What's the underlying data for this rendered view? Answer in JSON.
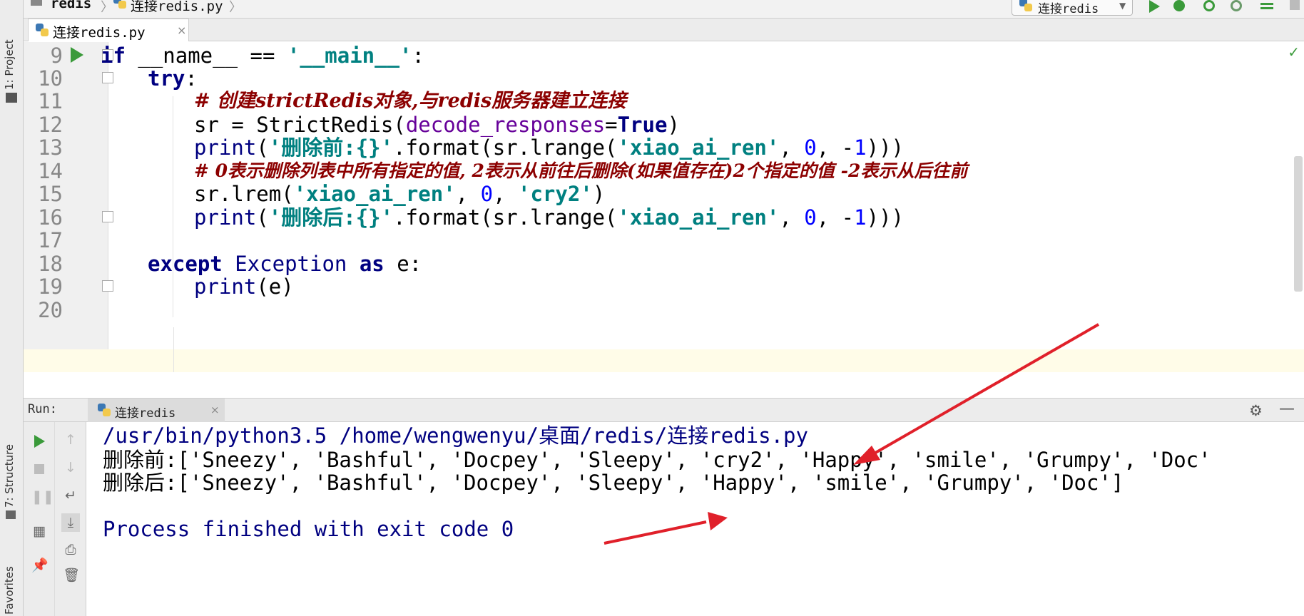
{
  "navbar": {
    "project": "redis",
    "file": "连接redis.py",
    "run_config": "连接redis"
  },
  "left_strip": {
    "project_tab": "1: Project",
    "structure_tab": "7: Structure",
    "favorites_tab": "Favorites"
  },
  "editor": {
    "tab_label": "连接redis.py",
    "tab_close": "×",
    "line_numbers": [
      "9",
      "10",
      "11",
      "12",
      "13",
      "14",
      "15",
      "16",
      "17",
      "18",
      "19",
      "20"
    ]
  },
  "code": {
    "l9_kw": "if",
    "l9_name": " __name__ == ",
    "l9_str": "'__main__'",
    "l9_colon": ":",
    "l10_kw": "try",
    "l10_colon": ":",
    "l11_comment": "# 创建strictRedis对象,与redis服务器建立连接",
    "l12_a": "sr = StrictRedis(",
    "l12_param": "decode_responses",
    "l12_eq": "=",
    "l12_kw": "True",
    "l12_b": ")",
    "l13_print": "print",
    "l13_a": "(",
    "l13_str1": "'删除前:{}'",
    "l13_b": ".format(sr.lrange(",
    "l13_str2": "'xiao_ai_ren'",
    "l13_c": ", ",
    "l13_n1": "0",
    "l13_d": ", -",
    "l13_n2": "1",
    "l13_e": ")))",
    "l14_comment": "# 0表示删除列表中所有指定的值, 2表示从前往后删除(如果值存在)2个指定的值 -2表示从后往前",
    "l15_a": "sr.lrem(",
    "l15_str1": "'xiao_ai_ren'",
    "l15_b": ", ",
    "l15_n": "0",
    "l15_c": ", ",
    "l15_str2": "'cry2'",
    "l15_d": ")",
    "l16_print": "print",
    "l16_a": "(",
    "l16_str1": "'删除后:{}'",
    "l16_b": ".format(sr.lrange(",
    "l16_str2": "'xiao_ai_ren'",
    "l16_c": ", ",
    "l16_n1": "0",
    "l16_d": ", -",
    "l16_n2": "1",
    "l16_e": ")))",
    "l18_kw1": "except",
    "l18_cls": " Exception ",
    "l18_kw2": "as",
    "l18_b": " e:",
    "l19_print": "print",
    "l19_a": "(e)"
  },
  "run_panel": {
    "label": "Run:",
    "tab_label": "连接redis",
    "tab_close": "×",
    "settings_icon": "gear-icon",
    "minimize_icon": "minimize-icon"
  },
  "console": {
    "cmd": "/usr/bin/python3.5 /home/wengwenyu/桌面/redis/连接redis.py",
    "before": "删除前:['Sneezy', 'Bashful', 'Docpey', 'Sleepy', 'cry2', 'Happy', 'smile', 'Grumpy', 'Doc'",
    "after": "删除后:['Sneezy', 'Bashful', 'Docpey', 'Sleepy', 'Happy', 'smile', 'Grumpy', 'Doc']",
    "exit": "Process finished with exit code 0"
  },
  "colors": {
    "keyword": "#000080",
    "string": "#008080",
    "number": "#0000ff",
    "comment": "#8c0000",
    "annotation_arrow": "#e0202a"
  }
}
